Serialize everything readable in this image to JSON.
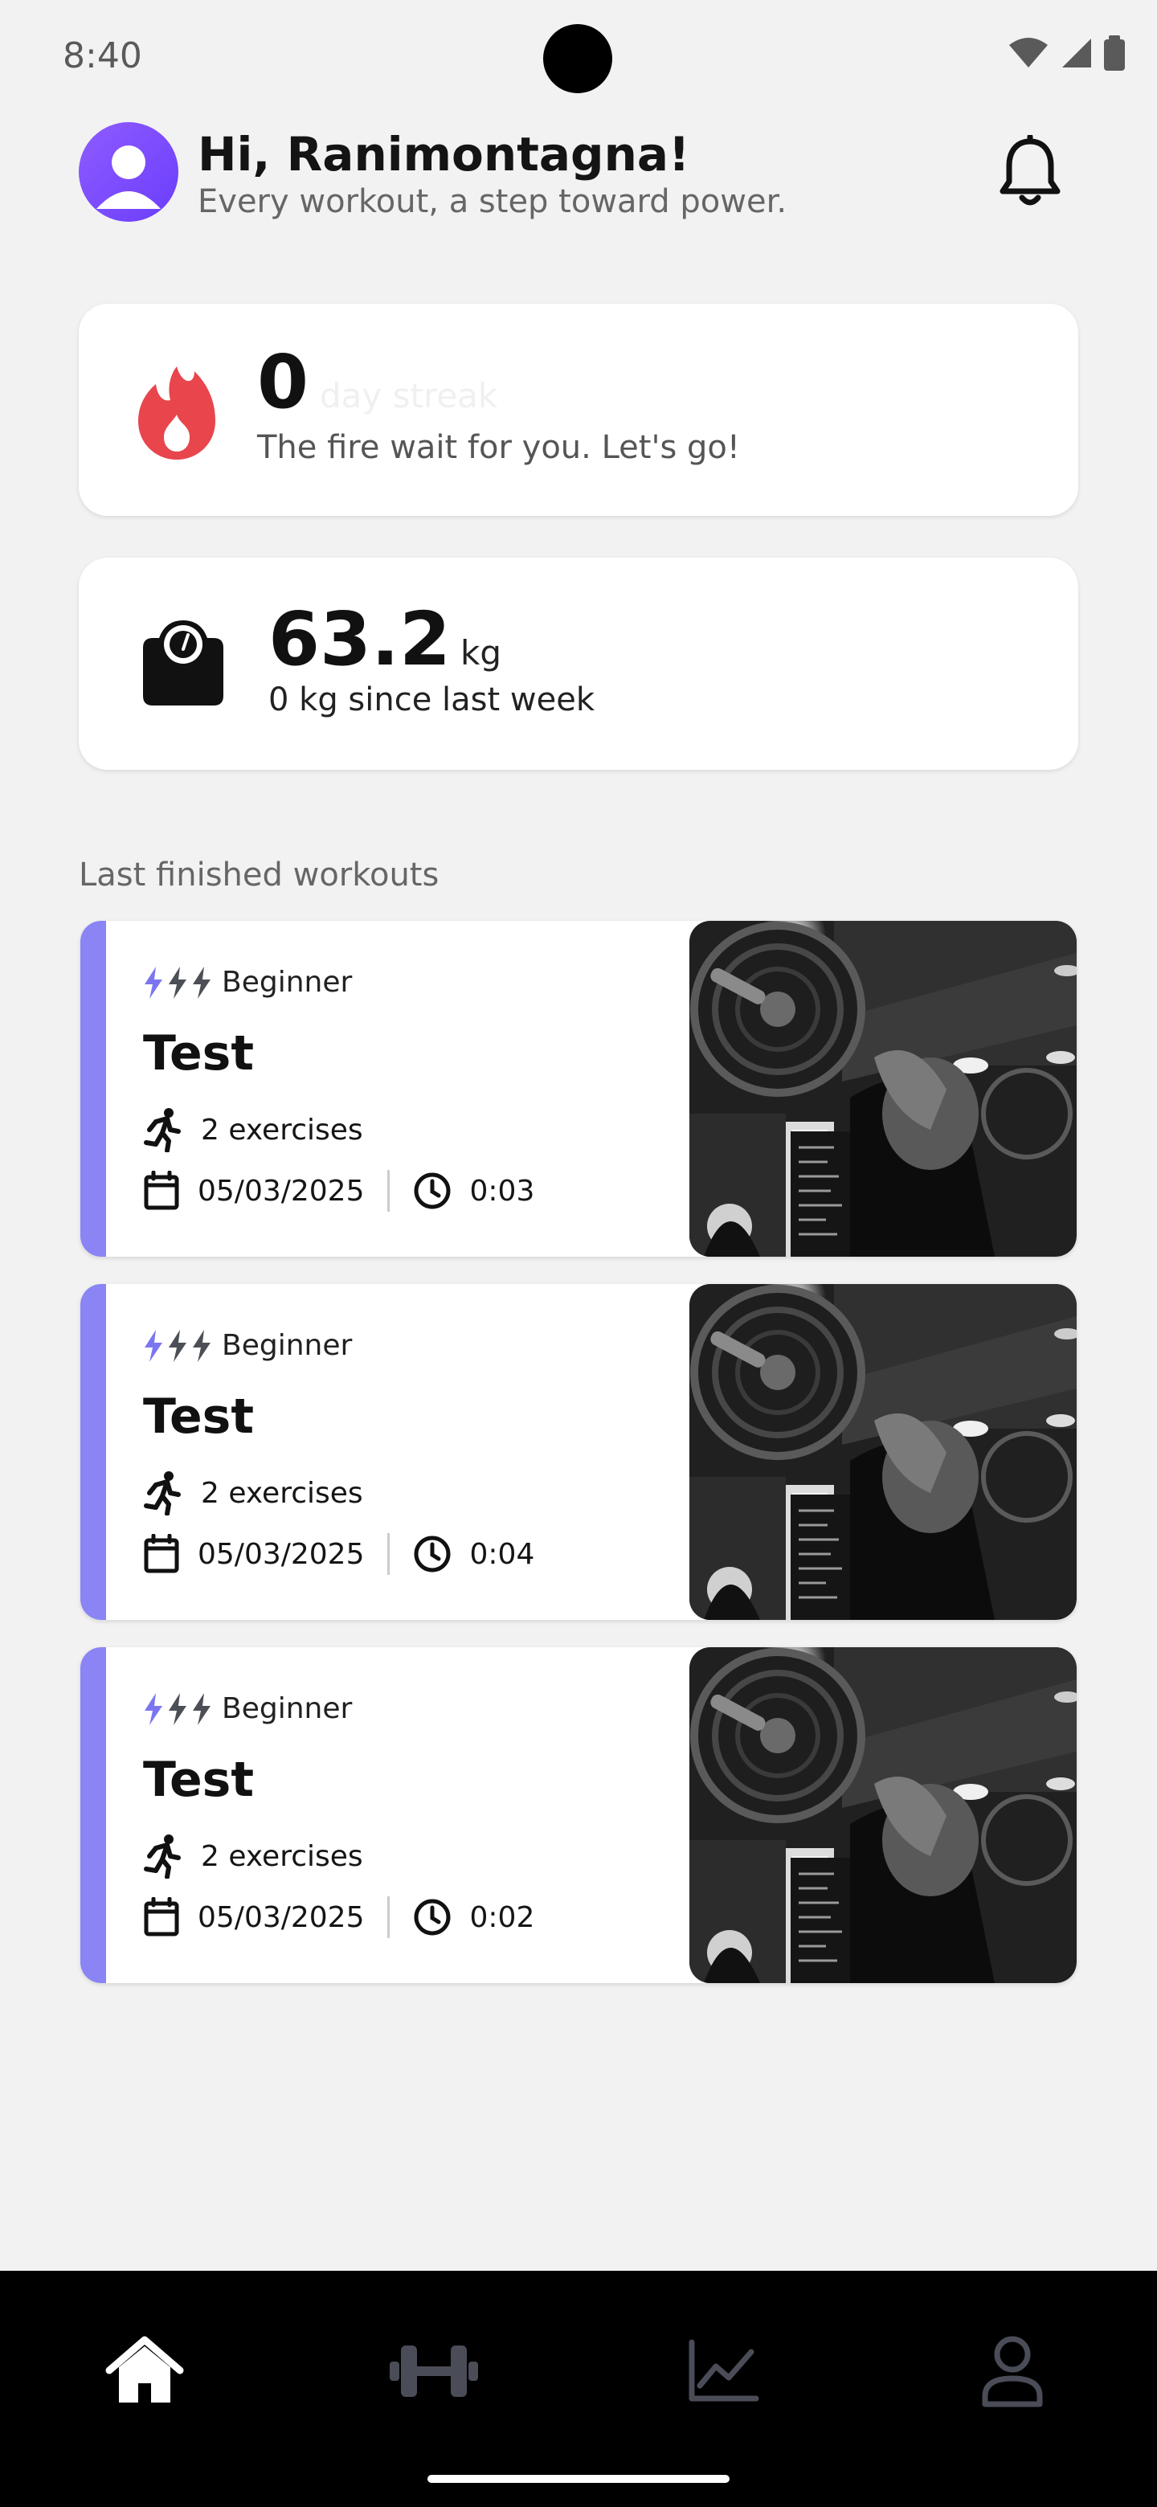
{
  "status": {
    "time": "8:40"
  },
  "header": {
    "greeting": "Hi, Ranimontagna!",
    "subtitle": "Every workout, a step toward power."
  },
  "streak": {
    "count": "0",
    "label": "day streak",
    "message": "The fire wait for you. Let's go!"
  },
  "weight": {
    "value": "63.2",
    "unit": "kg",
    "change": "0 kg since last week"
  },
  "workouts_section_label": "Last finished workouts",
  "workouts": [
    {
      "level": "Beginner",
      "title": "Test",
      "exercises": "2 exercises",
      "date": "05/03/2025",
      "duration": "0:03"
    },
    {
      "level": "Beginner",
      "title": "Test",
      "exercises": "2 exercises",
      "date": "05/03/2025",
      "duration": "0:04"
    },
    {
      "level": "Beginner",
      "title": "Test",
      "exercises": "2 exercises",
      "date": "05/03/2025",
      "duration": "0:02"
    }
  ],
  "nav": {
    "items": [
      "home-icon",
      "dumbbell-icon",
      "chart-icon",
      "profile-icon"
    ],
    "active": "home-icon"
  },
  "colors": {
    "accent": "#8a84f5",
    "fire": "#e8454d",
    "nav_bg": "#000000",
    "nav_inactive": "#4a4d57"
  }
}
